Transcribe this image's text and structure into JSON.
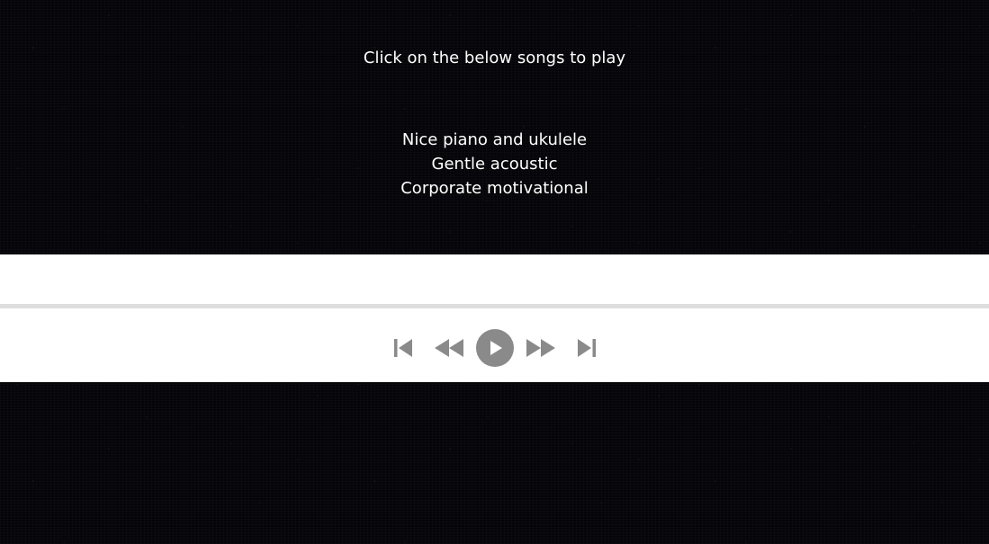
{
  "page": {
    "instructions": "Click on the below songs to play"
  },
  "playlist": {
    "songs": [
      "Nice piano and ukulele",
      "Gentle acoustic",
      "Corporate motivational"
    ]
  },
  "player": {
    "progress": 0,
    "controls": [
      {
        "name": "skip-back-icon"
      },
      {
        "name": "rewind-icon"
      },
      {
        "name": "play-icon"
      },
      {
        "name": "fast-forward-icon"
      },
      {
        "name": "skip-forward-icon"
      }
    ],
    "colors": {
      "icon": "#8a8a8a",
      "track": "#dedede",
      "panel": "#ffffff",
      "background": "#050509"
    }
  }
}
